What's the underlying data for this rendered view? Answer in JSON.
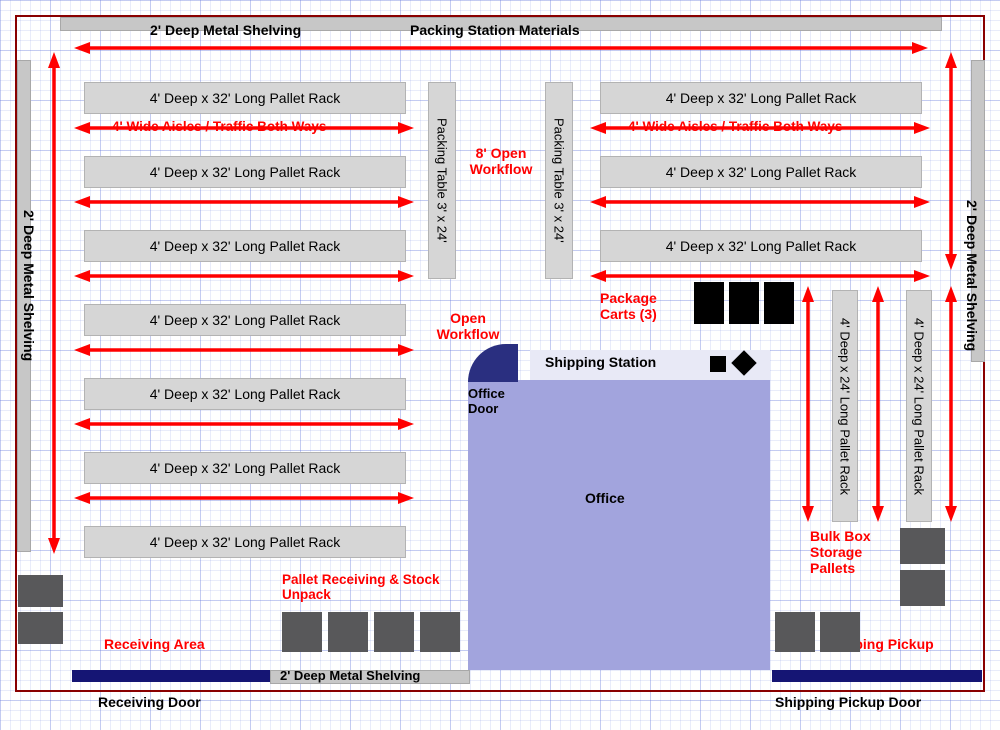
{
  "labels": {
    "top_shelving": "2' Deep Metal Shelving",
    "packing_station_materials": "Packing Station Materials",
    "left_shelving": "2' Deep Metal Shelving",
    "right_shelving": "2' Deep Metal Shelving",
    "bottom_shelving": "2' Deep Metal Shelving",
    "rack_label": "4' Deep x 32' Long Pallet Rack",
    "rack_v_label": "4' Deep x 24' Long Pallet Rack",
    "aisle_both": "4' Wide Aisles / Traffic Both Ways",
    "packing_table": "Packing Table 3' x 24'",
    "open_workflow_8": "8' Open Workflow",
    "open_workflow": "Open Workflow",
    "package_carts": "Package Carts (3)",
    "shipping_station": "Shipping Station",
    "office_door": "Office Door",
    "office": "Office",
    "bulk_box": "Bulk Box Storage Pallets",
    "pallet_receiving": "Pallet Receiving & Stock Unpack",
    "receiving_area": "Receiving Area",
    "shipping_pickup": "Shipping Pickup",
    "receiving_door": "Receiving Door",
    "shipping_door": "Shipping Pickup Door"
  }
}
